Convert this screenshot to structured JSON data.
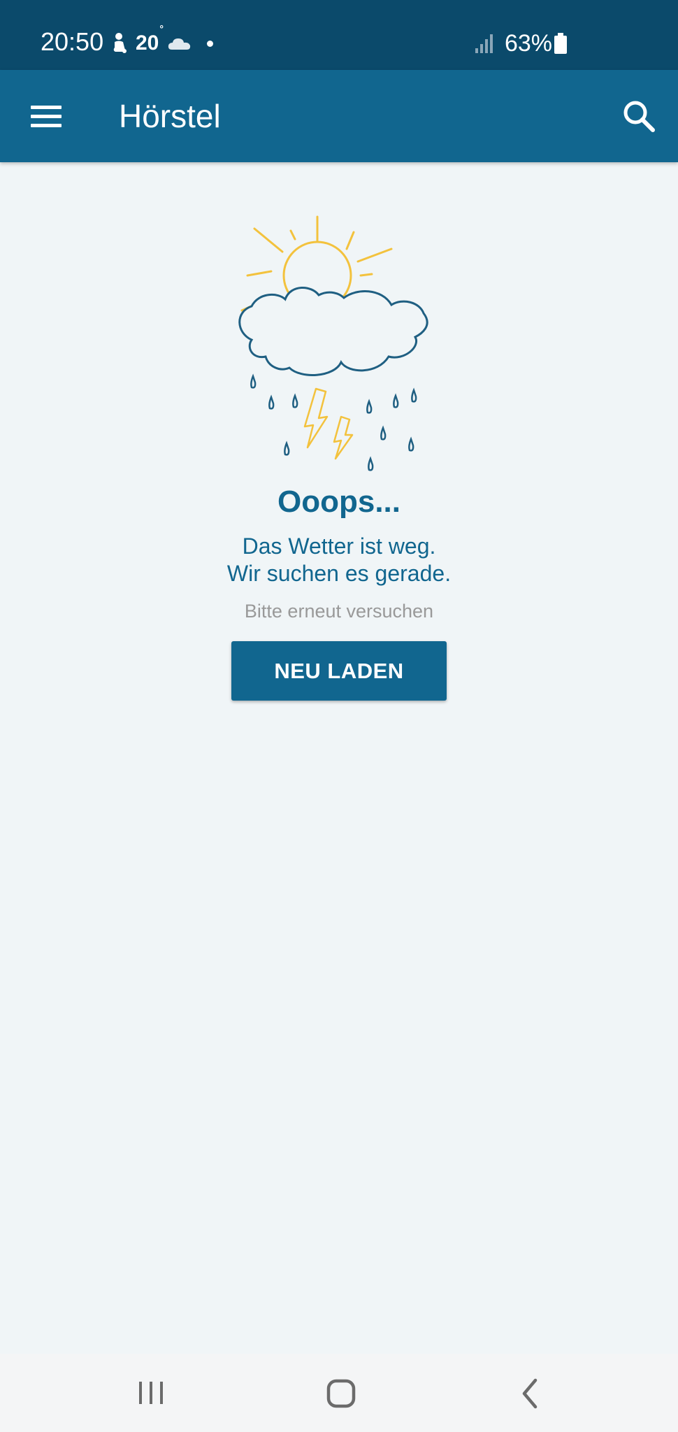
{
  "status_bar": {
    "time": "20:50",
    "temperature": "20",
    "temperature_degree": "°",
    "battery": "63%",
    "icons": [
      "baby-icon",
      "cloud-icon",
      "notification-dot",
      "signal-icon",
      "battery-icon"
    ]
  },
  "app_bar": {
    "title": "Hörstel",
    "menu_icon": "menu-icon",
    "search_icon": "search-icon",
    "background_color": "#11668f"
  },
  "error": {
    "illustration": "sun-cloud-thunderstorm-illustration",
    "title": "Ooops...",
    "message_line1": "Das Wetter ist weg.",
    "message_line2": "Wir suchen es gerade.",
    "hint": "Bitte erneut versuchen",
    "button_label": "NEU LADEN"
  },
  "nav_bar": {
    "items": [
      "recents-icon",
      "home-icon",
      "back-icon"
    ]
  },
  "colors": {
    "accent": "#11668f",
    "status_bar": "#0b4a6b",
    "sun": "#f3c23d",
    "cloud": "#1f5f82",
    "background": "#f0f5f7"
  }
}
